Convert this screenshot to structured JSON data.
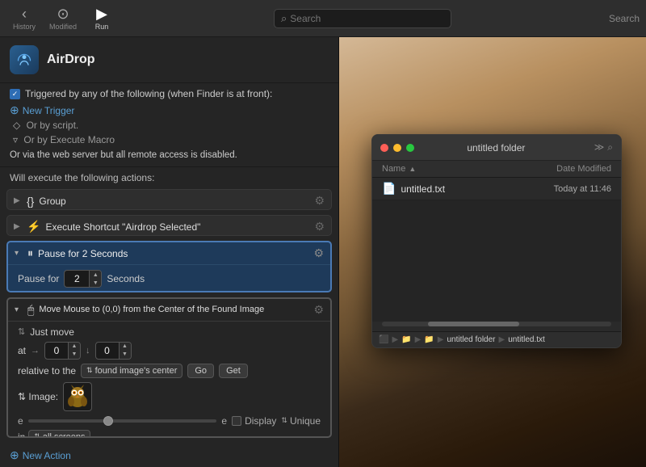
{
  "toolbar": {
    "history_label": "History",
    "modified_label": "Modified",
    "run_label": "Run",
    "search_placeholder": "Search",
    "search_label": "Search"
  },
  "macro": {
    "name": "AirDrop",
    "trigger_text": "Triggered by any of the following (when Finder is at front):",
    "new_trigger_label": "New Trigger",
    "or_by_script": "Or by script.",
    "or_by_execute": "Or by Execute Macro",
    "web_server_warning": "Or via the web server but all remote access is disabled.",
    "will_execute": "Will execute the following actions:"
  },
  "actions": [
    {
      "id": "group",
      "icon": "{}",
      "title": "Group",
      "expanded": false
    },
    {
      "id": "execute_shortcut",
      "icon": "⚡",
      "title": "Execute Shortcut \"Airdrop Selected\"",
      "expanded": false
    },
    {
      "id": "pause",
      "icon": "⏸",
      "title": "Pause for 2 Seconds",
      "expanded": true,
      "pause_label": "Pause for",
      "pause_value": "2",
      "seconds_label": "Seconds"
    },
    {
      "id": "move_mouse",
      "icon": "🖱",
      "title": "Move Mouse to (0,0) from the Center of the Found Image",
      "expanded": true,
      "just_move_label": "Just move",
      "at_label": "at",
      "x_value": "0",
      "y_value": "0",
      "relative_label": "relative to the",
      "found_center_label": "found image's center",
      "go_label": "Go",
      "get_label": "Get",
      "image_label": "Image:",
      "display_label": "Display",
      "unique_label": "Unique",
      "in_label": "in",
      "screens_label": "all screens"
    }
  ],
  "new_action_label": "New Action",
  "finder": {
    "title": "untitled folder",
    "col_name": "Name",
    "col_date": "Date Modified",
    "file_name": "untitled.txt",
    "file_date": "Today at 11:46",
    "path_items": [
      "⬛",
      "▶",
      "📁",
      "▶",
      "📁",
      "▶",
      "untitled folder",
      "▶",
      "untitled.txt"
    ]
  }
}
